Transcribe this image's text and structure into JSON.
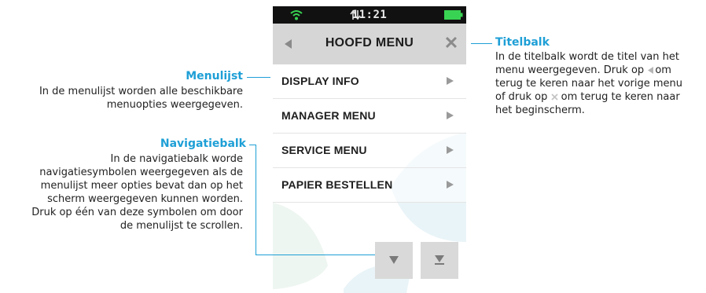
{
  "status_bar": {
    "time": "11:21",
    "wifi_icon": "wifi-icon",
    "signal_icon": "transfer-arrows-icon",
    "battery_icon": "battery-icon",
    "battery_color": "#39d353"
  },
  "title_bar": {
    "title": "HOOFD MENU",
    "back_icon": "back-triangle-icon",
    "close_icon": "close-icon",
    "close_glyph": "✕"
  },
  "menu": {
    "items": [
      {
        "label": "DISPLAY INFO"
      },
      {
        "label": "MANAGER MENU"
      },
      {
        "label": "SERVICE MENU"
      },
      {
        "label": "PAPIER BESTELLEN"
      }
    ],
    "arrow_icon": "chevron-right-icon"
  },
  "navigation": {
    "down_icon": "scroll-down-icon",
    "end_icon": "scroll-to-end-icon"
  },
  "annotations": {
    "menulijst": {
      "title": "Menulijst",
      "text_lines": [
        "In de menulijst worden alle beschikbare",
        "menuopties weergegeven."
      ]
    },
    "navigatiebalk": {
      "title": "Navigatiebalk",
      "text_lines": [
        "In de navigatiebalk worde",
        "navigatiesymbolen weergegeven als de",
        "menulijst meer opties bevat dan op het",
        "scherm weergegeven kunnen worden.",
        "Druk op één van deze symbolen om door",
        "de menulijst te scrollen."
      ]
    },
    "titelbalk": {
      "title": "Titelbalk",
      "line1": "In de titelbalk wordt de titel van het",
      "line2_before": "menu weergegeven. Druk op ",
      "line2_after": "om",
      "line3": "terug te keren naar het vorige menu",
      "line4_before": "of druk op ",
      "line4_after": "om terug te keren naar",
      "line5": "het beginscherm."
    }
  },
  "colors": {
    "accent": "#1e9fd6",
    "title_bar_bg": "#d6d6d6",
    "status_bar_bg": "#111111"
  }
}
